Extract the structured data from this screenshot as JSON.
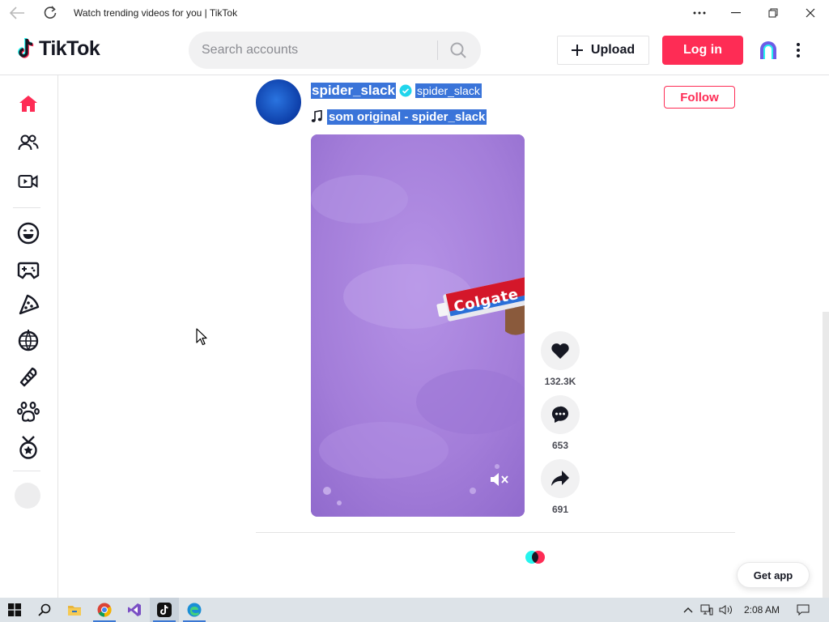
{
  "window": {
    "title": "Watch trending videos for you | TikTok"
  },
  "header": {
    "logo_text": "TikTok",
    "search_placeholder": "Search accounts",
    "upload_label": "Upload",
    "login_label": "Log in"
  },
  "sidebar": {
    "items": [
      {
        "icon": "home-icon",
        "active": true
      },
      {
        "icon": "following-icon"
      },
      {
        "icon": "live-icon"
      },
      {
        "icon": "comedy-icon"
      },
      {
        "icon": "gaming-icon"
      },
      {
        "icon": "food-icon"
      },
      {
        "icon": "dance-icon"
      },
      {
        "icon": "beauty-icon"
      },
      {
        "icon": "animals-icon"
      },
      {
        "icon": "sports-icon"
      }
    ]
  },
  "post": {
    "username": "spider_slack",
    "nickname": "spider_slack",
    "music": "som original - spider_slack",
    "follow_label": "Follow",
    "video_text": "Colgate",
    "likes": "132.3K",
    "comments": "653",
    "shares": "691"
  },
  "footer": {
    "get_app_label": "Get app"
  },
  "taskbar": {
    "clock": "2:08 AM",
    "apps": [
      "start-icon",
      "search-icon",
      "file-explorer-icon",
      "chrome-icon",
      "visual-studio-icon",
      "tiktok-icon",
      "edge-icon"
    ]
  },
  "colors": {
    "accent": "#fe2c55",
    "selection": "#3a74d9",
    "verified": "#20d5ec"
  }
}
